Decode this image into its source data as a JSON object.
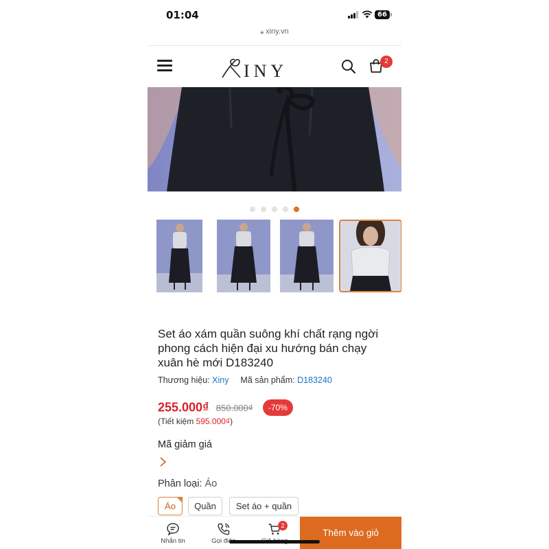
{
  "status_bar": {
    "time": "01:04",
    "battery": "66"
  },
  "browser": {
    "url": "xiny.vn"
  },
  "header": {
    "brand": "INY",
    "cart_count": "2",
    "icons": [
      "menu-icon",
      "xiny-logo",
      "search-icon",
      "cart-icon"
    ]
  },
  "gallery": {
    "dot_count": 5,
    "active_dot": 5,
    "thumbnail_count": 4,
    "active_thumbnail": 4
  },
  "product": {
    "title": "Set áo xám quần suông khí chất rạng ngời phong cách hiện đại xu hướng bán chạy xuân hè mới D183240",
    "brand_label": "Thương hiệu:",
    "brand_value": "Xiny",
    "sku_label": "Mã sản phẩm:",
    "sku_value": "D183240",
    "price": "255.000₫",
    "old_price": "850.000₫",
    "discount": "-70%",
    "save_prefix": "(Tiết kiệm ",
    "save_amount": "595.000₫",
    "save_suffix": ")"
  },
  "coupon": {
    "label": "Mã giảm giá"
  },
  "variants": {
    "label": "Phân loại:",
    "selected_value": "Áo",
    "options": [
      "Áo",
      "Quần",
      "Set áo + quần"
    ],
    "selected_index": 0
  },
  "bottom_bar": {
    "chat_label": "Nhắn tin",
    "call_label": "Gọi điện",
    "cart_label": "Giỏ hàng",
    "cart_count": "2",
    "add_to_cart": "Thêm vào giỏ"
  },
  "colors": {
    "accent": "#dc6a1f",
    "price_red": "#d92027",
    "link_blue": "#1a73c9",
    "badge_red": "#e53935"
  }
}
